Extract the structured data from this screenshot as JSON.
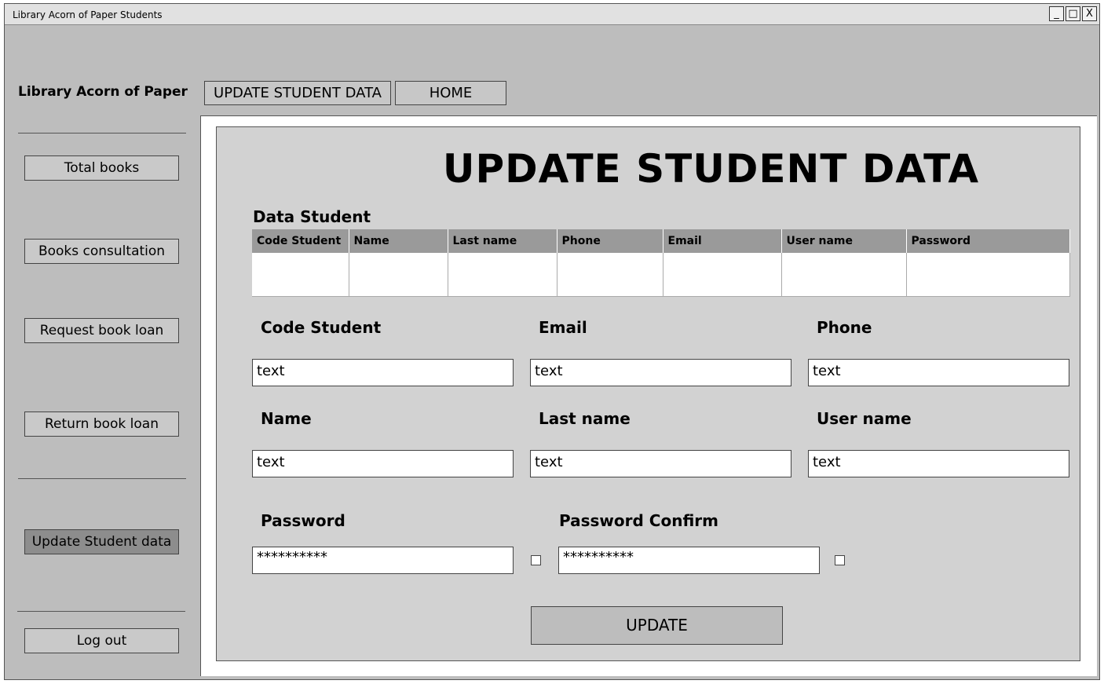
{
  "window": {
    "title": "Library Acorn of Paper Students",
    "controls": {
      "minimize": "_",
      "maximize": "□",
      "close": "X"
    }
  },
  "header": {
    "logo_text": "Library Acorn of Paper",
    "nav": {
      "update_label": "UPDATE STUDENT DATA",
      "home_label": "HOME"
    }
  },
  "sidebar": {
    "items": [
      {
        "label": "Total books"
      },
      {
        "label": "Books consultation"
      },
      {
        "label": "Request book loan"
      },
      {
        "label": "Return book loan"
      },
      {
        "label": "Update Student data"
      },
      {
        "label": "Log out"
      }
    ]
  },
  "main": {
    "title": "UPDATE STUDENT DATA",
    "table": {
      "title": "Data Student",
      "columns": [
        "Code Student",
        "Name",
        "Last name",
        "Phone",
        "Email",
        "User name",
        "Password"
      ]
    },
    "form": {
      "code_student": {
        "label": "Code Student",
        "value": "text"
      },
      "email": {
        "label": "Email",
        "value": "text"
      },
      "phone": {
        "label": "Phone",
        "value": "text"
      },
      "name": {
        "label": "Name",
        "value": "text"
      },
      "last_name": {
        "label": "Last name",
        "value": "text"
      },
      "user_name": {
        "label": "User name",
        "value": "text"
      },
      "password": {
        "label": "Password",
        "value": "**********"
      },
      "password_confirm": {
        "label": "Password Confirm",
        "value": "**********"
      }
    },
    "update_label": "UPDATE"
  }
}
